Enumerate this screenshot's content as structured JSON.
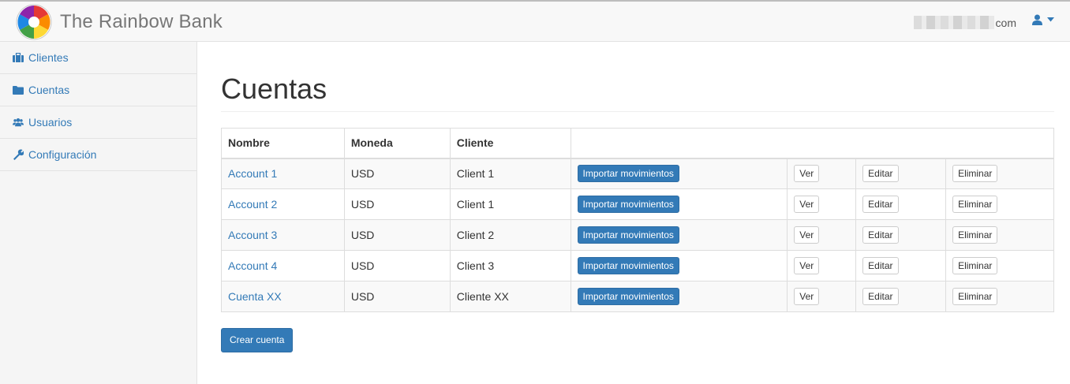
{
  "brand": {
    "name": "The Rainbow Bank",
    "icon": "rainbow-logo"
  },
  "user": {
    "email_visible": "com",
    "icon": "user-icon"
  },
  "sidebar": {
    "items": [
      {
        "label": "Clientes",
        "icon": "briefcase-icon"
      },
      {
        "label": "Cuentas",
        "icon": "folder-icon"
      },
      {
        "label": "Usuarios",
        "icon": "users-icon"
      },
      {
        "label": "Configuración",
        "icon": "wrench-icon"
      }
    ]
  },
  "page": {
    "title": "Cuentas"
  },
  "table": {
    "headers": [
      "Nombre",
      "Moneda",
      "Cliente",
      ""
    ],
    "rows": [
      {
        "nombre": "Account 1",
        "moneda": "USD",
        "cliente": "Client 1"
      },
      {
        "nombre": "Account 2",
        "moneda": "USD",
        "cliente": "Client 1"
      },
      {
        "nombre": "Account 3",
        "moneda": "USD",
        "cliente": "Client 2"
      },
      {
        "nombre": "Account 4",
        "moneda": "USD",
        "cliente": "Client 3"
      },
      {
        "nombre": "Cuenta XX",
        "moneda": "USD",
        "cliente": "Cliente XX"
      }
    ],
    "actions": {
      "import": "Importar movimientos",
      "view": "Ver",
      "edit": "Editar",
      "delete": "Eliminar"
    }
  },
  "create_button": "Crear cuenta",
  "colors": {
    "link": "#337ab7",
    "primary": "#337ab7",
    "sidebar_bg": "#f5f5f5",
    "navbar_bg": "#f8f8f8"
  }
}
